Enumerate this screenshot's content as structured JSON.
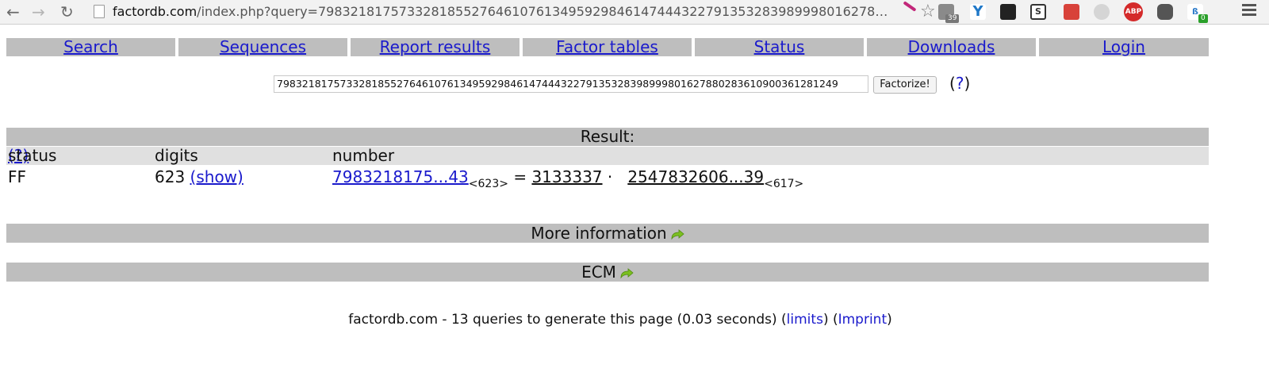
{
  "browser": {
    "url_host": "factordb.com",
    "url_rest": "/index.php?query=798321817573328185527646107613495929846147444322791353283989998016278…",
    "extensions": [
      {
        "icon": "printer-icon",
        "badge": "39"
      },
      {
        "icon": "y-icon"
      },
      {
        "icon": "glasses-icon"
      },
      {
        "icon": "s-icon",
        "label": "S"
      },
      {
        "icon": "floppy-icon"
      },
      {
        "icon": "globe-icon"
      },
      {
        "icon": "adblock-icon",
        "label": "ABP"
      },
      {
        "icon": "evernote-icon"
      },
      {
        "icon": "bluetooth-icon",
        "badge": "0"
      }
    ]
  },
  "nav": [
    "Search",
    "Sequences",
    "Report results",
    "Factor tables",
    "Status",
    "Downloads",
    "Login"
  ],
  "search": {
    "value": "79832181757332818552764610761349592984614744432279135328398999801627880283610900361281249",
    "button": "Factorize!",
    "help": "?"
  },
  "result": {
    "title": "Result:",
    "columns": {
      "status": "status",
      "status_help": "(?)",
      "digits": "digits",
      "number": "number"
    },
    "row": {
      "status": "FF",
      "digits": "623",
      "show": "(show)",
      "number": "7983218175...43",
      "number_sub": "<623>",
      "equals": "=",
      "factor1": "3133337",
      "dot": "·",
      "factor2": "2547832606...39",
      "factor2_sub": "<617>"
    }
  },
  "sections": {
    "more_info": "More information",
    "ecm": "ECM"
  },
  "footer": {
    "text": "factordb.com - 13 queries to generate this page (0.03 seconds) (",
    "limits": "limits",
    "mid": ") (",
    "imprint": "Imprint",
    "end": ")"
  },
  "colors": {
    "link": "#1a1acc",
    "bar": "#bebebe",
    "header_row": "#e0e0e0",
    "arrow": "#7cc020"
  }
}
